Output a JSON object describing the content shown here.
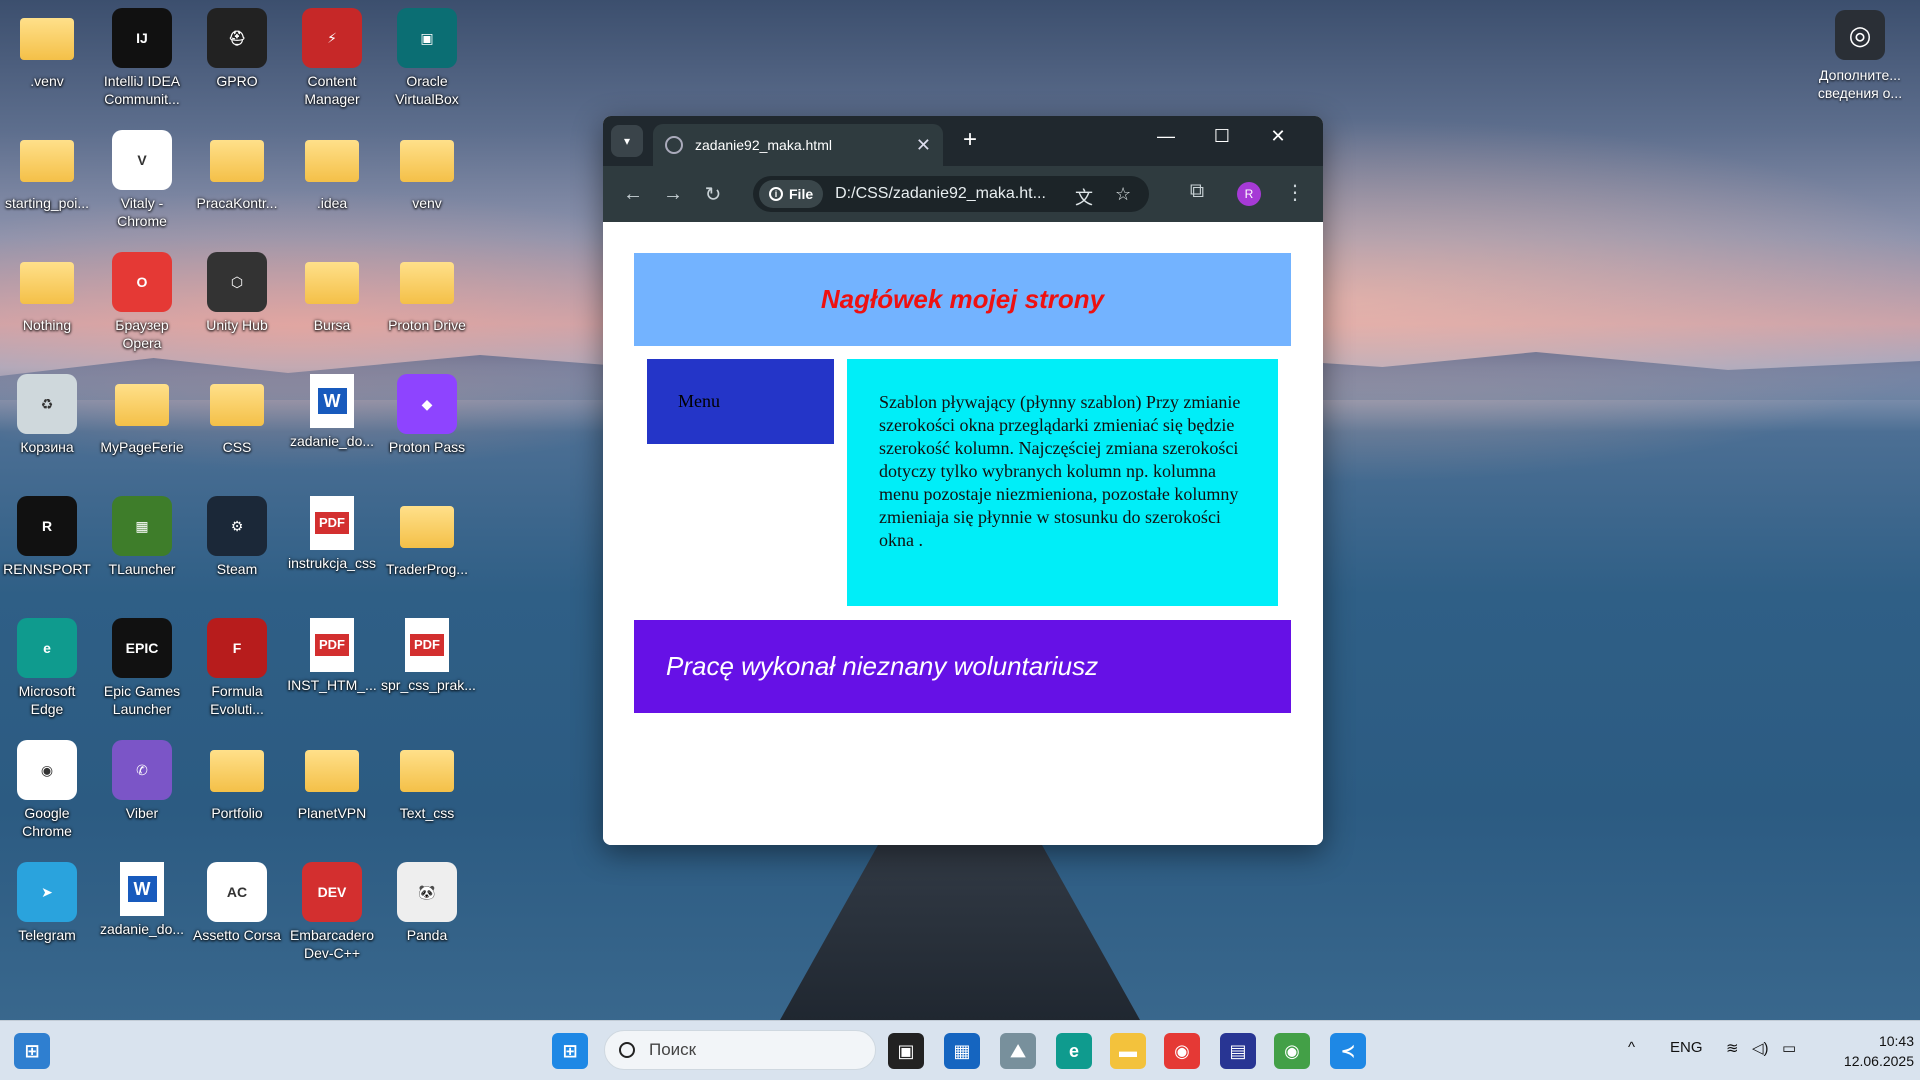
{
  "desktop": {
    "icons": [
      {
        "label": ".venv",
        "glyph": ""
      },
      {
        "label": "IntelliJ IDEA Communit...",
        "glyph": "IJ"
      },
      {
        "label": "GPRO",
        "glyph": "⛑"
      },
      {
        "label": "Content Manager",
        "glyph": "⚡"
      },
      {
        "label": "Oracle VirtualBox",
        "glyph": "▣"
      },
      {
        "label": "starting_poi...",
        "glyph": ""
      },
      {
        "label": "Vitaly - Chrome",
        "glyph": "V"
      },
      {
        "label": "PracaKontr...",
        "glyph": ""
      },
      {
        "label": ".idea",
        "glyph": ""
      },
      {
        "label": "venv",
        "glyph": ""
      },
      {
        "label": "Nothing",
        "glyph": ""
      },
      {
        "label": "Браузер Opera",
        "glyph": "O"
      },
      {
        "label": "Unity Hub",
        "glyph": "⬡"
      },
      {
        "label": "Bursa",
        "glyph": ""
      },
      {
        "label": "Proton Drive",
        "glyph": ""
      },
      {
        "label": "Корзина",
        "glyph": "♻"
      },
      {
        "label": "MyPageFerie",
        "glyph": ""
      },
      {
        "label": "CSS",
        "glyph": ""
      },
      {
        "label": "zadanie_do...",
        "glyph": "W"
      },
      {
        "label": "Proton Pass",
        "glyph": "◆"
      },
      {
        "label": "RENNSPORT",
        "glyph": "R"
      },
      {
        "label": "TLauncher",
        "glyph": "▦"
      },
      {
        "label": "Steam",
        "glyph": "⚙"
      },
      {
        "label": "instrukcja_css",
        "glyph": "PDF"
      },
      {
        "label": "TraderProg...",
        "glyph": ""
      },
      {
        "label": "Microsoft Edge",
        "glyph": "e"
      },
      {
        "label": "Epic Games Launcher",
        "glyph": "EPIC"
      },
      {
        "label": "Formula Evoluti...",
        "glyph": "F"
      },
      {
        "label": "INST_HTM_...",
        "glyph": "PDF"
      },
      {
        "label": "spr_css_prak...",
        "glyph": "PDF"
      },
      {
        "label": "Google Chrome",
        "glyph": "◉"
      },
      {
        "label": "Viber",
        "glyph": "✆"
      },
      {
        "label": "Portfolio",
        "glyph": ""
      },
      {
        "label": "PlanetVPN",
        "glyph": ""
      },
      {
        "label": "Text_css",
        "glyph": ""
      },
      {
        "label": "Telegram",
        "glyph": "➤"
      },
      {
        "label": "zadanie_do...",
        "glyph": "W"
      },
      {
        "label": "Assetto Corsa",
        "glyph": "AC"
      },
      {
        "label": "Embarcadero Dev-C++",
        "glyph": "DEV"
      },
      {
        "label": "Panda",
        "glyph": "🐼"
      }
    ],
    "corner_widget": {
      "label": "Дополните... сведения о...",
      "icon": "widget-icon"
    }
  },
  "browser": {
    "tab_title": "zadanie92_maka.html",
    "tab_close": "✕",
    "new_tab": "+",
    "minimize": "—",
    "maximize": "☐",
    "close": "✕",
    "scheme_chip": "File",
    "url": "D:/CSS/zadanie92_maka.ht...",
    "profile_initial": "R",
    "page": {
      "header": "Nagłówek mojej strony",
      "menu": "Menu",
      "content": "Szablon pływający (płynny szablon) Przy zmianie szerokości okna przeglądarki zmieniać się będzie szerokość kolumn. Najczęściej zmiana szerokości dotyczy tylko wybranych kolumn np. kolumna menu pozostaje niezmieniona, pozostałe kolumny zmieniaja się płynnie w stosunku do szerokości okna .",
      "footer": "Pracę wykonał nieznany woluntariusz",
      "colors": {
        "header_bg": "#73b3ff",
        "header_text": "#ee1111",
        "menu_bg": "#2435c8",
        "content_bg": "#00eef8",
        "footer_bg": "#6611e6"
      }
    }
  },
  "taskbar": {
    "search_placeholder": "Поиск",
    "language": "ENG",
    "time": "10:43",
    "date": "12.06.2025"
  }
}
